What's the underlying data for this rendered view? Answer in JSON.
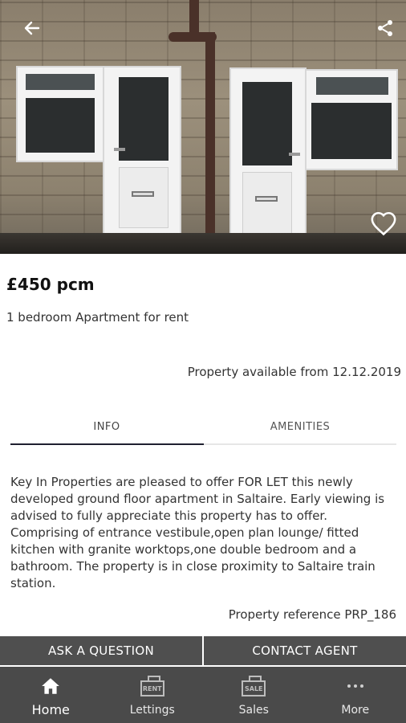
{
  "header": {
    "back_icon": "arrow-left-icon",
    "share_icon": "share-icon",
    "favourite_icon": "heart-outline-icon"
  },
  "listing": {
    "price": "£450 pcm",
    "subtitle": "1 bedroom Apartment for rent",
    "availability": "Property available from 12.12.2019",
    "description": "Key In Properties are pleased to offer FOR LET this newly developed ground floor apartment in Saltaire. Early viewing is advised to fully appreciate this property has to offer. Comprising of entrance vestibule,open plan lounge/ fitted kitchen with granite worktops,one double bedroom and a bathroom. The property is in close proximity to Saltaire train station.",
    "reference": "Property reference PRP_186"
  },
  "tabs": [
    {
      "label": "INFO",
      "active": true
    },
    {
      "label": "AMENITIES",
      "active": false
    }
  ],
  "actions": {
    "ask_label": "ASK A QUESTION",
    "contact_label": "CONTACT AGENT"
  },
  "nav": [
    {
      "label": "Home",
      "icon": "home-icon",
      "active": true
    },
    {
      "label": "Lettings",
      "icon": "rent-sign-icon",
      "sign_text": "RENT"
    },
    {
      "label": "Sales",
      "icon": "sale-sign-icon",
      "sign_text": "SALE"
    },
    {
      "label": "More",
      "icon": "more-dots-icon"
    }
  ],
  "colors": {
    "action_bg": "#4f4f4f",
    "nav_bg": "#4a4a4a",
    "tab_indicator": "#1f2030"
  }
}
